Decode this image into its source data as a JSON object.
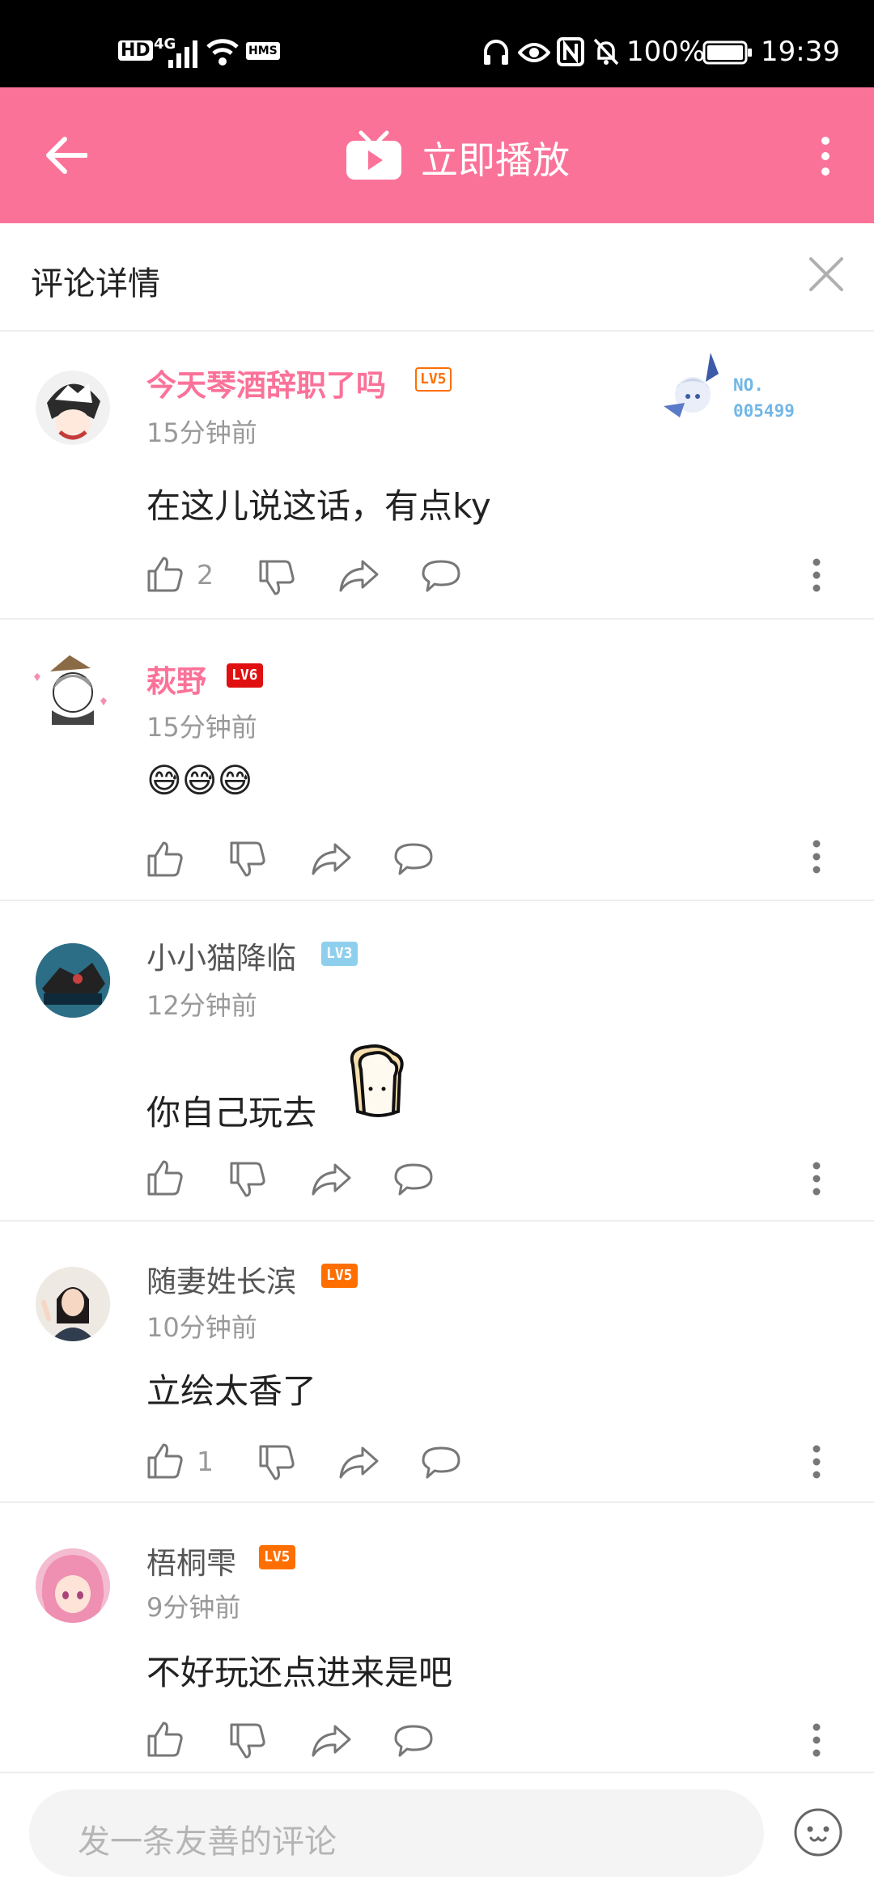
{
  "status_bar": {
    "hd": "HD",
    "network": "4G",
    "hms": "HMS",
    "battery": "100%",
    "time": "19:39"
  },
  "app_bar": {
    "title": "立即播放"
  },
  "panel": {
    "title": "评论详情"
  },
  "comments": [
    {
      "user": "今天琴酒辞职了吗",
      "level": "LV5",
      "time": "15分钟前",
      "text": "在这儿说这话，有点ky",
      "likes": "2",
      "badge": {
        "label": "NO.",
        "number": "005499"
      }
    },
    {
      "user": "萩野",
      "level": "LV6",
      "time": "15分钟前",
      "text": "😅😅😅",
      "likes": ""
    },
    {
      "user": "小小猫降临",
      "level": "LV3",
      "time": "12分钟前",
      "text": "你自己玩去",
      "likes": ""
    },
    {
      "user": "随妻姓长滨",
      "level": "LV5",
      "time": "10分钟前",
      "text": "立绘太香了",
      "likes": "1"
    },
    {
      "user": "梧桐雫",
      "level": "LV5",
      "time": "9分钟前",
      "text": "不好玩还点进来是吧",
      "likes": ""
    }
  ],
  "footer": {
    "placeholder": "发一条友善的评论"
  },
  "colors": {
    "accent": "#fb7299",
    "lv5": "#ff6f00",
    "lv6": "#e01010",
    "lv3": "#8fcfee"
  }
}
